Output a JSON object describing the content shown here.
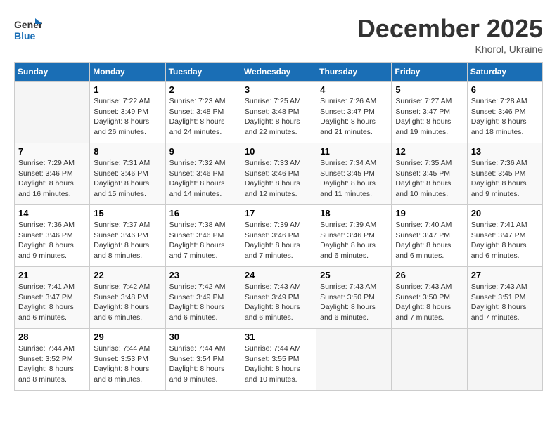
{
  "header": {
    "logo_line1": "General",
    "logo_line2": "Blue",
    "month_title": "December 2025",
    "subtitle": "Khorol, Ukraine"
  },
  "days_of_week": [
    "Sunday",
    "Monday",
    "Tuesday",
    "Wednesday",
    "Thursday",
    "Friday",
    "Saturday"
  ],
  "weeks": [
    [
      {
        "day": "",
        "sunrise": "",
        "sunset": "",
        "daylight": ""
      },
      {
        "day": "1",
        "sunrise": "Sunrise: 7:22 AM",
        "sunset": "Sunset: 3:49 PM",
        "daylight": "Daylight: 8 hours and 26 minutes."
      },
      {
        "day": "2",
        "sunrise": "Sunrise: 7:23 AM",
        "sunset": "Sunset: 3:48 PM",
        "daylight": "Daylight: 8 hours and 24 minutes."
      },
      {
        "day": "3",
        "sunrise": "Sunrise: 7:25 AM",
        "sunset": "Sunset: 3:48 PM",
        "daylight": "Daylight: 8 hours and 22 minutes."
      },
      {
        "day": "4",
        "sunrise": "Sunrise: 7:26 AM",
        "sunset": "Sunset: 3:47 PM",
        "daylight": "Daylight: 8 hours and 21 minutes."
      },
      {
        "day": "5",
        "sunrise": "Sunrise: 7:27 AM",
        "sunset": "Sunset: 3:47 PM",
        "daylight": "Daylight: 8 hours and 19 minutes."
      },
      {
        "day": "6",
        "sunrise": "Sunrise: 7:28 AM",
        "sunset": "Sunset: 3:46 PM",
        "daylight": "Daylight: 8 hours and 18 minutes."
      }
    ],
    [
      {
        "day": "7",
        "sunrise": "Sunrise: 7:29 AM",
        "sunset": "Sunset: 3:46 PM",
        "daylight": "Daylight: 8 hours and 16 minutes."
      },
      {
        "day": "8",
        "sunrise": "Sunrise: 7:31 AM",
        "sunset": "Sunset: 3:46 PM",
        "daylight": "Daylight: 8 hours and 15 minutes."
      },
      {
        "day": "9",
        "sunrise": "Sunrise: 7:32 AM",
        "sunset": "Sunset: 3:46 PM",
        "daylight": "Daylight: 8 hours and 14 minutes."
      },
      {
        "day": "10",
        "sunrise": "Sunrise: 7:33 AM",
        "sunset": "Sunset: 3:46 PM",
        "daylight": "Daylight: 8 hours and 12 minutes."
      },
      {
        "day": "11",
        "sunrise": "Sunrise: 7:34 AM",
        "sunset": "Sunset: 3:45 PM",
        "daylight": "Daylight: 8 hours and 11 minutes."
      },
      {
        "day": "12",
        "sunrise": "Sunrise: 7:35 AM",
        "sunset": "Sunset: 3:45 PM",
        "daylight": "Daylight: 8 hours and 10 minutes."
      },
      {
        "day": "13",
        "sunrise": "Sunrise: 7:36 AM",
        "sunset": "Sunset: 3:45 PM",
        "daylight": "Daylight: 8 hours and 9 minutes."
      }
    ],
    [
      {
        "day": "14",
        "sunrise": "Sunrise: 7:36 AM",
        "sunset": "Sunset: 3:46 PM",
        "daylight": "Daylight: 8 hours and 9 minutes."
      },
      {
        "day": "15",
        "sunrise": "Sunrise: 7:37 AM",
        "sunset": "Sunset: 3:46 PM",
        "daylight": "Daylight: 8 hours and 8 minutes."
      },
      {
        "day": "16",
        "sunrise": "Sunrise: 7:38 AM",
        "sunset": "Sunset: 3:46 PM",
        "daylight": "Daylight: 8 hours and 7 minutes."
      },
      {
        "day": "17",
        "sunrise": "Sunrise: 7:39 AM",
        "sunset": "Sunset: 3:46 PM",
        "daylight": "Daylight: 8 hours and 7 minutes."
      },
      {
        "day": "18",
        "sunrise": "Sunrise: 7:39 AM",
        "sunset": "Sunset: 3:46 PM",
        "daylight": "Daylight: 8 hours and 6 minutes."
      },
      {
        "day": "19",
        "sunrise": "Sunrise: 7:40 AM",
        "sunset": "Sunset: 3:47 PM",
        "daylight": "Daylight: 8 hours and 6 minutes."
      },
      {
        "day": "20",
        "sunrise": "Sunrise: 7:41 AM",
        "sunset": "Sunset: 3:47 PM",
        "daylight": "Daylight: 8 hours and 6 minutes."
      }
    ],
    [
      {
        "day": "21",
        "sunrise": "Sunrise: 7:41 AM",
        "sunset": "Sunset: 3:47 PM",
        "daylight": "Daylight: 8 hours and 6 minutes."
      },
      {
        "day": "22",
        "sunrise": "Sunrise: 7:42 AM",
        "sunset": "Sunset: 3:48 PM",
        "daylight": "Daylight: 8 hours and 6 minutes."
      },
      {
        "day": "23",
        "sunrise": "Sunrise: 7:42 AM",
        "sunset": "Sunset: 3:49 PM",
        "daylight": "Daylight: 8 hours and 6 minutes."
      },
      {
        "day": "24",
        "sunrise": "Sunrise: 7:43 AM",
        "sunset": "Sunset: 3:49 PM",
        "daylight": "Daylight: 8 hours and 6 minutes."
      },
      {
        "day": "25",
        "sunrise": "Sunrise: 7:43 AM",
        "sunset": "Sunset: 3:50 PM",
        "daylight": "Daylight: 8 hours and 6 minutes."
      },
      {
        "day": "26",
        "sunrise": "Sunrise: 7:43 AM",
        "sunset": "Sunset: 3:50 PM",
        "daylight": "Daylight: 8 hours and 7 minutes."
      },
      {
        "day": "27",
        "sunrise": "Sunrise: 7:43 AM",
        "sunset": "Sunset: 3:51 PM",
        "daylight": "Daylight: 8 hours and 7 minutes."
      }
    ],
    [
      {
        "day": "28",
        "sunrise": "Sunrise: 7:44 AM",
        "sunset": "Sunset: 3:52 PM",
        "daylight": "Daylight: 8 hours and 8 minutes."
      },
      {
        "day": "29",
        "sunrise": "Sunrise: 7:44 AM",
        "sunset": "Sunset: 3:53 PM",
        "daylight": "Daylight: 8 hours and 8 minutes."
      },
      {
        "day": "30",
        "sunrise": "Sunrise: 7:44 AM",
        "sunset": "Sunset: 3:54 PM",
        "daylight": "Daylight: 8 hours and 9 minutes."
      },
      {
        "day": "31",
        "sunrise": "Sunrise: 7:44 AM",
        "sunset": "Sunset: 3:55 PM",
        "daylight": "Daylight: 8 hours and 10 minutes."
      },
      {
        "day": "",
        "sunrise": "",
        "sunset": "",
        "daylight": ""
      },
      {
        "day": "",
        "sunrise": "",
        "sunset": "",
        "daylight": ""
      },
      {
        "day": "",
        "sunrise": "",
        "sunset": "",
        "daylight": ""
      }
    ]
  ]
}
